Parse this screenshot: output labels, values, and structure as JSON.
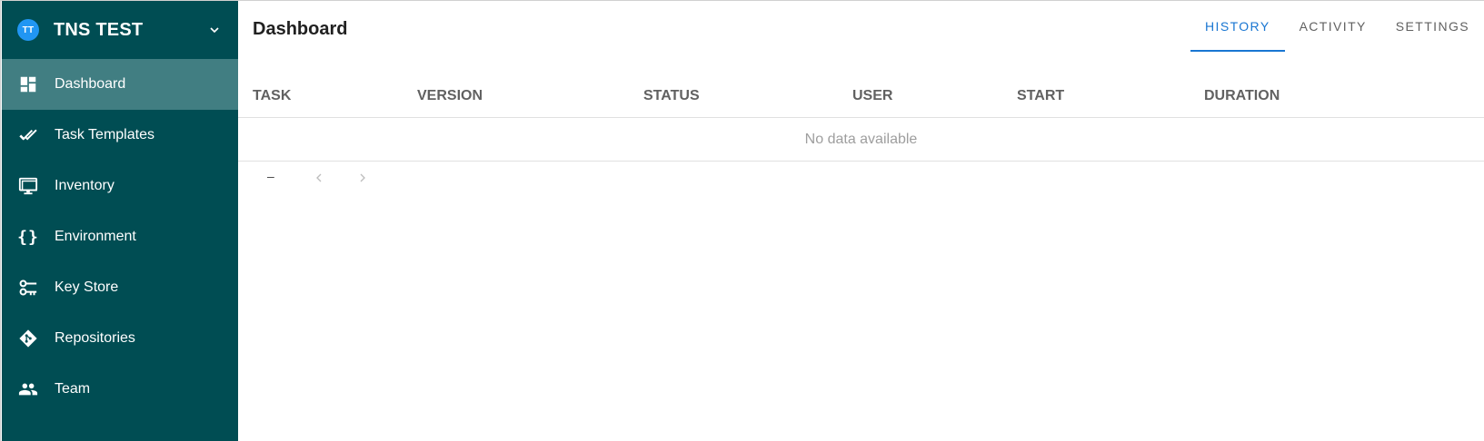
{
  "project": {
    "avatar_initials": "TT",
    "name": "TNS TEST",
    "chevron_icon": "chevron-down-icon"
  },
  "sidebar": {
    "items": [
      {
        "label": "Dashboard",
        "icon": "dashboard-icon",
        "active": true
      },
      {
        "label": "Task Templates",
        "icon": "double-check-icon",
        "active": false
      },
      {
        "label": "Inventory",
        "icon": "monitor-icon",
        "active": false
      },
      {
        "label": "Environment",
        "icon": "curly-braces-icon",
        "active": false
      },
      {
        "label": "Key Store",
        "icon": "key-icon",
        "active": false
      },
      {
        "label": "Repositories",
        "icon": "git-icon",
        "active": false
      },
      {
        "label": "Team",
        "icon": "people-icon",
        "active": false
      }
    ]
  },
  "header": {
    "title": "Dashboard",
    "tabs": [
      {
        "label": "HISTORY",
        "active": true
      },
      {
        "label": "ACTIVITY",
        "active": false
      },
      {
        "label": "SETTINGS",
        "active": false
      }
    ]
  },
  "table": {
    "columns": [
      "TASK",
      "VERSION",
      "STATUS",
      "USER",
      "START",
      "DURATION"
    ],
    "empty_text": "No data available"
  },
  "pagination": {
    "range_text": "–",
    "prev_icon": "chevron-left-icon",
    "next_icon": "chevron-right-icon"
  },
  "colors": {
    "sidebar_bg": "#004d53",
    "sidebar_active": "#417e82",
    "accent": "#1976d2",
    "avatar": "#2196f3"
  }
}
